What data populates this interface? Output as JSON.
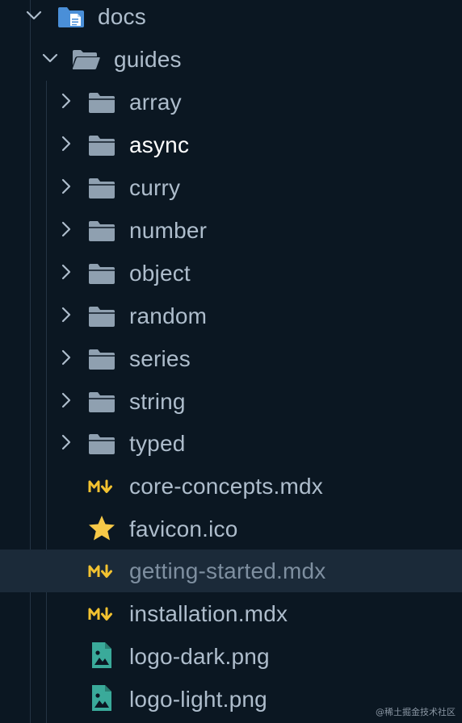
{
  "explorer": {
    "root": {
      "name": "docs",
      "icon": "docs-folder-icon",
      "expanded": true
    },
    "subfolder": {
      "name": "guides",
      "icon": "folder-open-icon",
      "expanded": true
    },
    "items": [
      {
        "name": "array",
        "type": "folder",
        "icon": "folder-icon"
      },
      {
        "name": "async",
        "type": "folder",
        "icon": "folder-icon",
        "highlighted": true
      },
      {
        "name": "curry",
        "type": "folder",
        "icon": "folder-icon"
      },
      {
        "name": "number",
        "type": "folder",
        "icon": "folder-icon"
      },
      {
        "name": "object",
        "type": "folder",
        "icon": "folder-icon"
      },
      {
        "name": "random",
        "type": "folder",
        "icon": "folder-icon"
      },
      {
        "name": "series",
        "type": "folder",
        "icon": "folder-icon"
      },
      {
        "name": "string",
        "type": "folder",
        "icon": "folder-icon"
      },
      {
        "name": "typed",
        "type": "folder",
        "icon": "folder-icon"
      },
      {
        "name": "core-concepts.mdx",
        "type": "file",
        "icon": "markdown-icon"
      },
      {
        "name": "favicon.ico",
        "type": "file",
        "icon": "star-icon"
      },
      {
        "name": "getting-started.mdx",
        "type": "file",
        "icon": "markdown-icon",
        "selected": true
      },
      {
        "name": "installation.mdx",
        "type": "file",
        "icon": "markdown-icon"
      },
      {
        "name": "logo-dark.png",
        "type": "file",
        "icon": "image-icon"
      },
      {
        "name": "logo-light.png",
        "type": "file",
        "icon": "image-icon"
      }
    ]
  },
  "watermark": "@稀土掘金技术社区",
  "colors": {
    "background": "#0b1722",
    "selected_row": "#1b2a39",
    "label": "#aebdcc",
    "folder": "#8fa0b0",
    "docs_folder": "#4a8fd8",
    "markdown": "#f2c230",
    "star": "#f7c948",
    "image": "#3aaa9a"
  }
}
